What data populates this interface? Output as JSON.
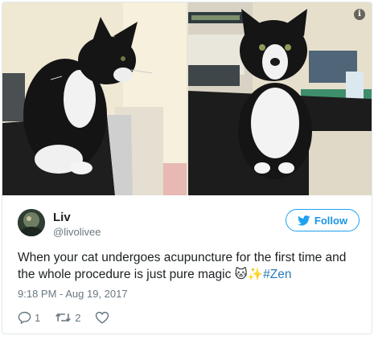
{
  "tweet": {
    "author_name": "Liv",
    "author_handle": "@livolivee",
    "follow_label": "Follow",
    "text_main": "When your cat undergoes acupuncture for the first time and the whole procedure is just pure magic ",
    "text_emoji": "🐱✨",
    "hashtag": "#Zen",
    "timestamp": "9:18 PM - Aug 19, 2017",
    "reply_count": "1",
    "retweet_count": "2"
  },
  "media": {
    "photos": [
      "cat-side-profile-photo",
      "cat-front-facing-photo"
    ],
    "info_glyph": "i"
  },
  "colors": {
    "accent": "#1da1f2",
    "link": "#2b7bb9",
    "meta": "#697882",
    "text": "#1c2022",
    "border": "#e1e8ed"
  },
  "icons": [
    "info-icon",
    "twitter-bird-icon",
    "reply-icon",
    "retweet-icon",
    "like-heart-icon"
  ]
}
